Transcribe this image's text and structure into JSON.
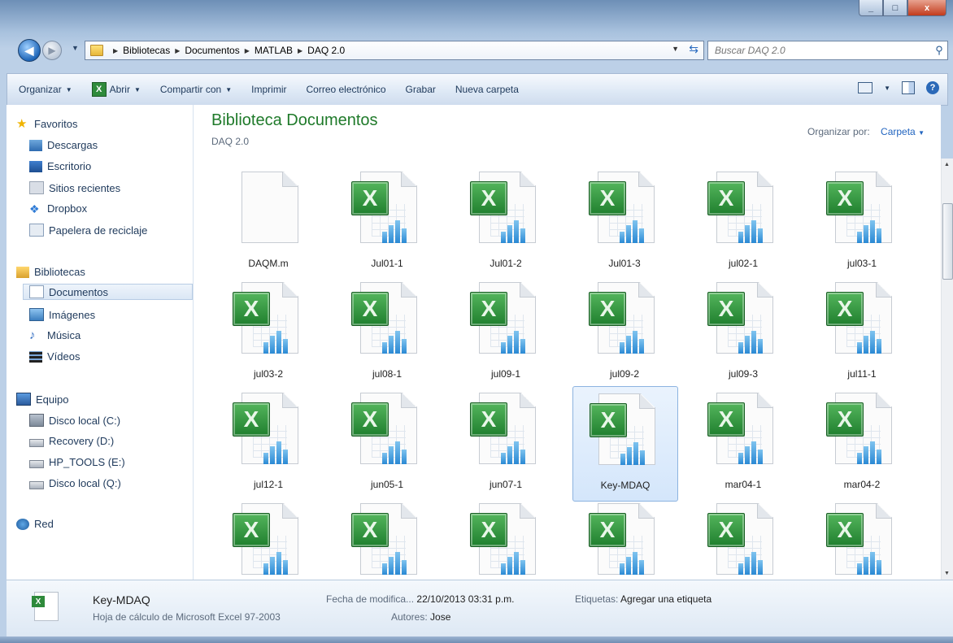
{
  "window": {
    "caption_min": "_",
    "caption_max": "□",
    "caption_close": "x"
  },
  "address": {
    "breadcrumb": [
      "Bibliotecas",
      "Documentos",
      "MATLAB",
      "DAQ 2.0"
    ],
    "search_placeholder": "Buscar DAQ 2.0"
  },
  "toolbar": {
    "organize": "Organizar",
    "open": "Abrir",
    "share": "Compartir con",
    "print": "Imprimir",
    "email": "Correo electrónico",
    "burn": "Grabar",
    "new_folder": "Nueva carpeta",
    "help": "?"
  },
  "nav": {
    "favorites": "Favoritos",
    "downloads": "Descargas",
    "desktop": "Escritorio",
    "recent": "Sitios recientes",
    "dropbox": "Dropbox",
    "recycle": "Papelera de reciclaje",
    "libraries": "Bibliotecas",
    "documents": "Documentos",
    "images": "Imágenes",
    "music": "Música",
    "videos": "Vídeos",
    "computer": "Equipo",
    "disk_c": "Disco local (C:)",
    "recovery": "Recovery (D:)",
    "hp_tools": "HP_TOOLS (E:)",
    "disk_q": "Disco local (Q:)",
    "network": "Red"
  },
  "content": {
    "title": "Biblioteca Documentos",
    "subtitle": "DAQ 2.0",
    "arrange_label": "Organizar por:",
    "arrange_value": "Carpeta"
  },
  "files": [
    {
      "name": "DAQM.m",
      "type": "blank"
    },
    {
      "name": "Jul01-1",
      "type": "excel"
    },
    {
      "name": "Jul01-2",
      "type": "excel"
    },
    {
      "name": "Jul01-3",
      "type": "excel"
    },
    {
      "name": "jul02-1",
      "type": "excel"
    },
    {
      "name": "jul03-1",
      "type": "excel"
    },
    {
      "name": "jul03-2",
      "type": "excel"
    },
    {
      "name": "jul08-1",
      "type": "excel"
    },
    {
      "name": "jul09-1",
      "type": "excel"
    },
    {
      "name": "jul09-2",
      "type": "excel"
    },
    {
      "name": "jul09-3",
      "type": "excel"
    },
    {
      "name": "jul11-1",
      "type": "excel"
    },
    {
      "name": "jul12-1",
      "type": "excel"
    },
    {
      "name": "jun05-1",
      "type": "excel"
    },
    {
      "name": "jun07-1",
      "type": "excel"
    },
    {
      "name": "Key-MDAQ",
      "type": "excel",
      "selected": true
    },
    {
      "name": "mar04-1",
      "type": "excel"
    },
    {
      "name": "mar04-2",
      "type": "excel"
    },
    {
      "name": "",
      "type": "excel"
    },
    {
      "name": "",
      "type": "excel"
    },
    {
      "name": "",
      "type": "excel"
    },
    {
      "name": "",
      "type": "excel"
    },
    {
      "name": "",
      "type": "excel"
    },
    {
      "name": "",
      "type": "excel"
    }
  ],
  "details": {
    "name": "Key-MDAQ",
    "type": "Hoja de cálculo de Microsoft Excel 97-2003",
    "modified_label": "Fecha de modifica...",
    "modified_value": "22/10/2013 03:31 p.m.",
    "authors_label": "Autores:",
    "authors_value": "Jose",
    "tags_label": "Etiquetas:",
    "tags_value": "Agregar una etiqueta"
  }
}
